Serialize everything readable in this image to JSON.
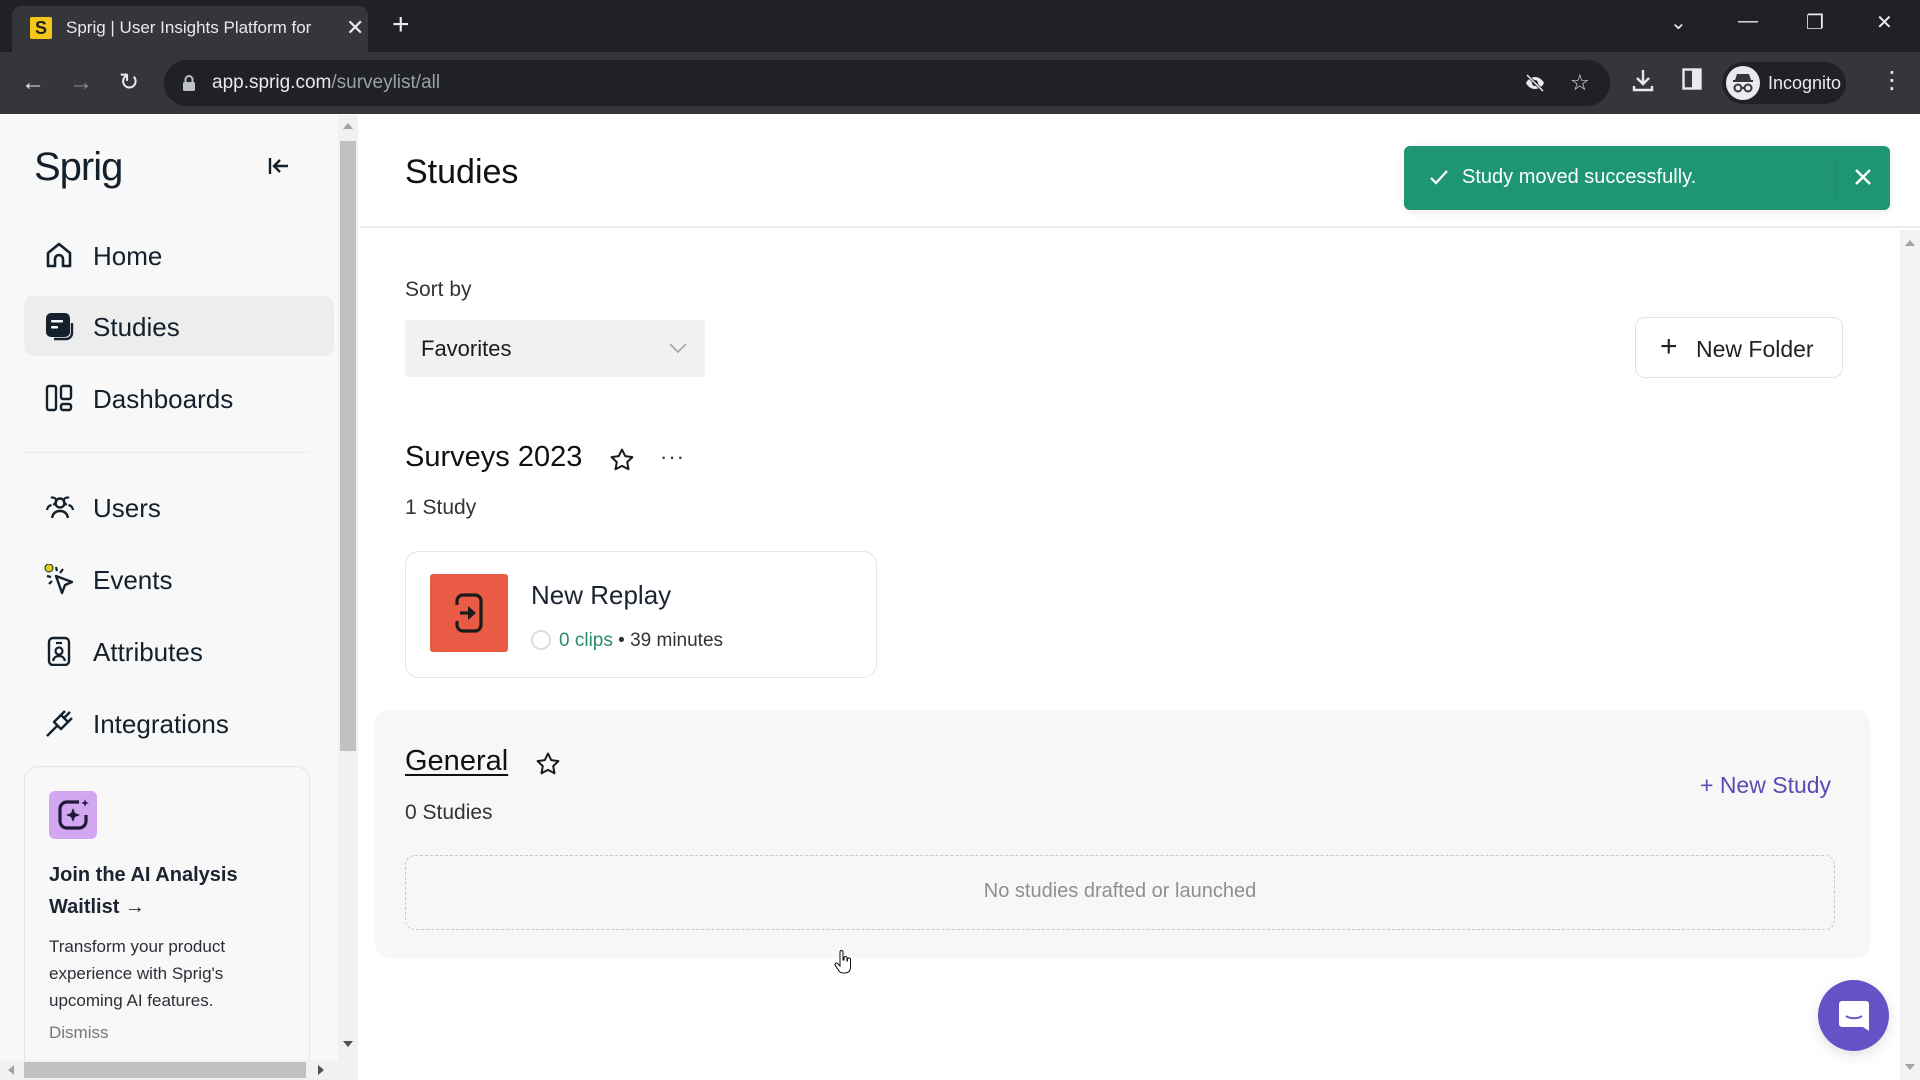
{
  "browser": {
    "tab_title": "Sprig | User Insights Platform for",
    "tab_favicon": "S",
    "url_host": "app.sprig.com",
    "url_path": "/surveylist/all",
    "profile_label": "Incognito"
  },
  "sidebar": {
    "logo": "Sprig",
    "items": [
      {
        "label": "Home",
        "icon": "home-icon",
        "active": false
      },
      {
        "label": "Studies",
        "icon": "studies-icon",
        "active": true
      },
      {
        "label": "Dashboards",
        "icon": "dashboards-icon",
        "active": false
      },
      {
        "label": "Users",
        "icon": "users-icon",
        "active": false
      },
      {
        "label": "Events",
        "icon": "events-icon",
        "active": false
      },
      {
        "label": "Attributes",
        "icon": "attributes-icon",
        "active": false
      },
      {
        "label": "Integrations",
        "icon": "integrations-icon",
        "active": false
      }
    ],
    "promo": {
      "title": "Join the AI Analysis Waitlist →",
      "description": "Transform your product experience with Sprig's upcoming AI features.",
      "dismiss": "Dismiss"
    }
  },
  "header": {
    "title": "Studies"
  },
  "toast": {
    "message": "Study moved successfully.",
    "color": "#1f9672"
  },
  "controls": {
    "sort_label": "Sort by",
    "sort_value": "Favorites",
    "new_folder": "New Folder"
  },
  "folders": [
    {
      "name": "Surveys 2023",
      "count": "1 Study",
      "studies": [
        {
          "name": "New Replay",
          "clips": "0 clips",
          "separator": "•",
          "duration": "39 minutes",
          "thumb_color": "#ea5b45"
        }
      ]
    },
    {
      "name": "General",
      "count": "0 Studies",
      "new_study": "+ New Study",
      "empty_message": "No studies drafted or launched"
    }
  ],
  "accent_colors": {
    "new_study_link": "#5a4cb2",
    "chat_button": "#6353c6"
  }
}
